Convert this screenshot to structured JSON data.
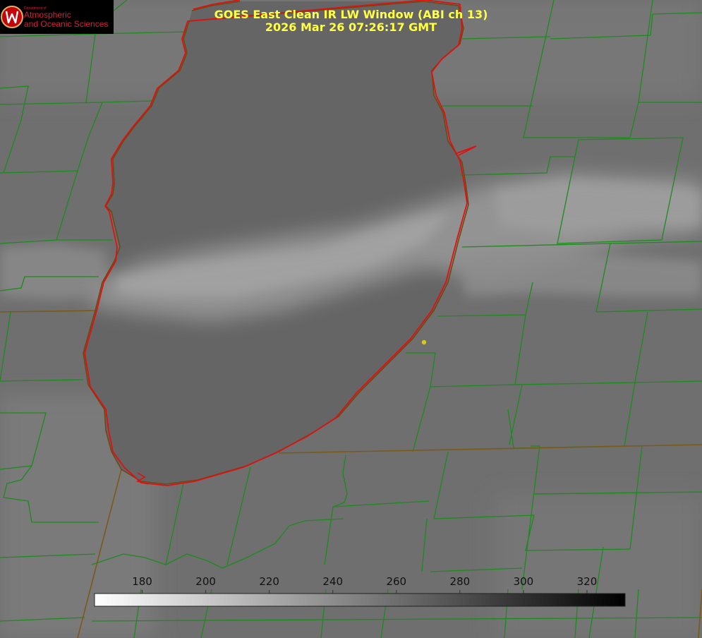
{
  "title": {
    "line1": "GOES East Clean IR LW Window (ABI ch 13)",
    "line2": "2026 Mar 26 07:26:17 GMT"
  },
  "logo": {
    "dept": "Department of",
    "line1": "Atmospheric",
    "line2": "and Oceanic Sciences",
    "icon": "uw-crest-icon",
    "color": "#c5050c"
  },
  "colorbar": {
    "ticks": [
      "180",
      "200",
      "220",
      "240",
      "260",
      "280",
      "300",
      "320"
    ],
    "tick_values": [
      180,
      200,
      220,
      240,
      260,
      280,
      300,
      320
    ],
    "range": [
      165,
      332
    ],
    "gradient": "white to black"
  },
  "colors": {
    "title": "#ffff44",
    "shoreline": "#e01010",
    "borders": "#1d8a1d",
    "marker": "#d8c81a"
  },
  "marker": {
    "icon": "station-dot-icon"
  }
}
